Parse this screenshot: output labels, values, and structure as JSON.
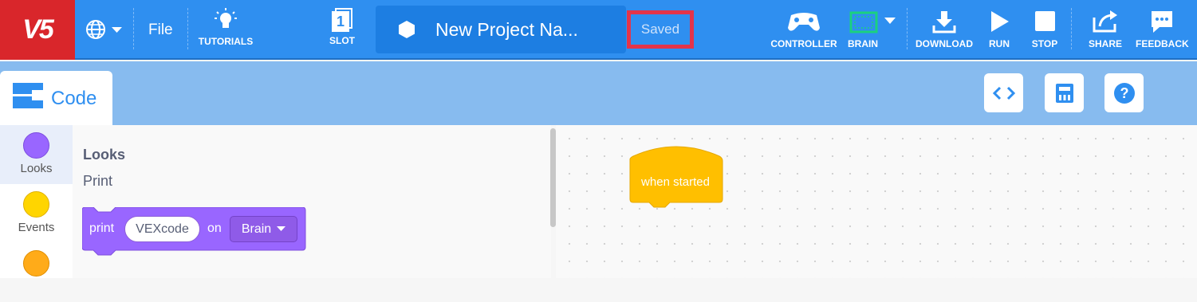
{
  "app": {
    "logo": "V5"
  },
  "toolbar": {
    "file_label": "File",
    "tutorials_label": "TUTORIALS",
    "slot_number": "1",
    "slot_label": "SLOT",
    "project_name": "New Project Na...",
    "save_status": "Saved",
    "controller_label": "CONTROLLER",
    "brain_label": "BRAIN",
    "download_label": "DOWNLOAD",
    "run_label": "RUN",
    "stop_label": "STOP",
    "share_label": "SHARE",
    "feedback_label": "FEEDBACK"
  },
  "tabs": {
    "code_label": "Code"
  },
  "categories": [
    {
      "label": "Looks",
      "color": "#9966ff"
    },
    {
      "label": "Events",
      "color": "#ffd500"
    },
    {
      "label": "",
      "color": "#ffab19"
    }
  ],
  "palette": {
    "title": "Looks",
    "subtitle": "Print",
    "print_block": {
      "word_print": "print",
      "value": "VEXcode",
      "word_on": "on",
      "target": "Brain"
    }
  },
  "workspace": {
    "hat_block": "when started"
  },
  "colors": {
    "accent": "#2f8ff0",
    "looks": "#9966ff",
    "events": "#ffbf00",
    "brand": "#d9262b"
  }
}
